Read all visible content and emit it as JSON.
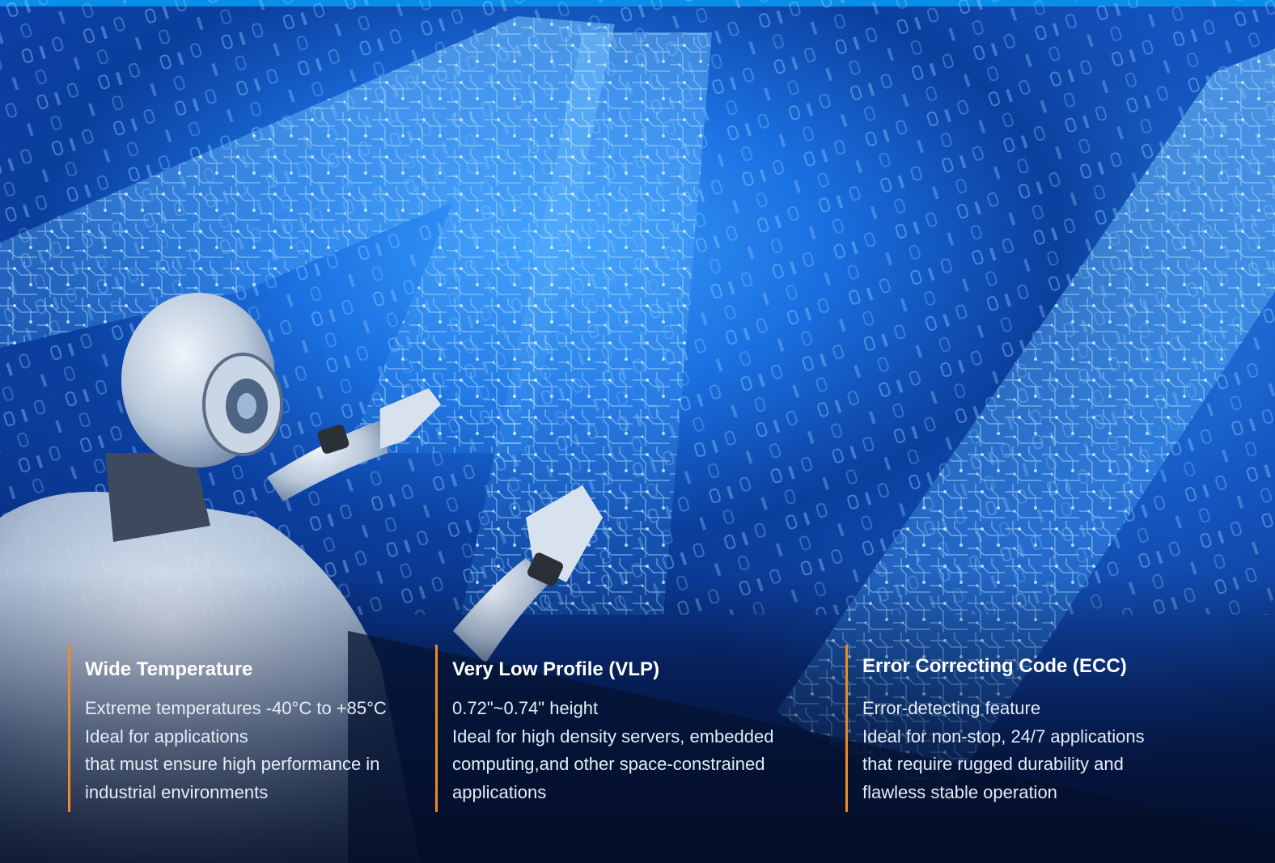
{
  "features": [
    {
      "title": "Wide Temperature",
      "lines": [
        "Extreme temperatures -40°C to +85°C",
        "Ideal for applications",
        "that must ensure high performance in",
        "industrial environments"
      ]
    },
    {
      "title": "Very Low Profile (VLP)",
      "lines": [
        "0.72\"~0.74\" height",
        "Ideal for high density servers, embedded",
        "computing,and other space-constrained",
        "applications"
      ]
    },
    {
      "title": "Error Correcting Code (ECC)",
      "lines": [
        "Error-detecting feature",
        "Ideal for non-stop, 24/7 applications",
        "that require rugged durability and",
        "flawless stable operation"
      ]
    }
  ],
  "colors": {
    "accent": "#f08a24",
    "top_bar": "#0a8ee8",
    "background": "#0c3fa8"
  }
}
